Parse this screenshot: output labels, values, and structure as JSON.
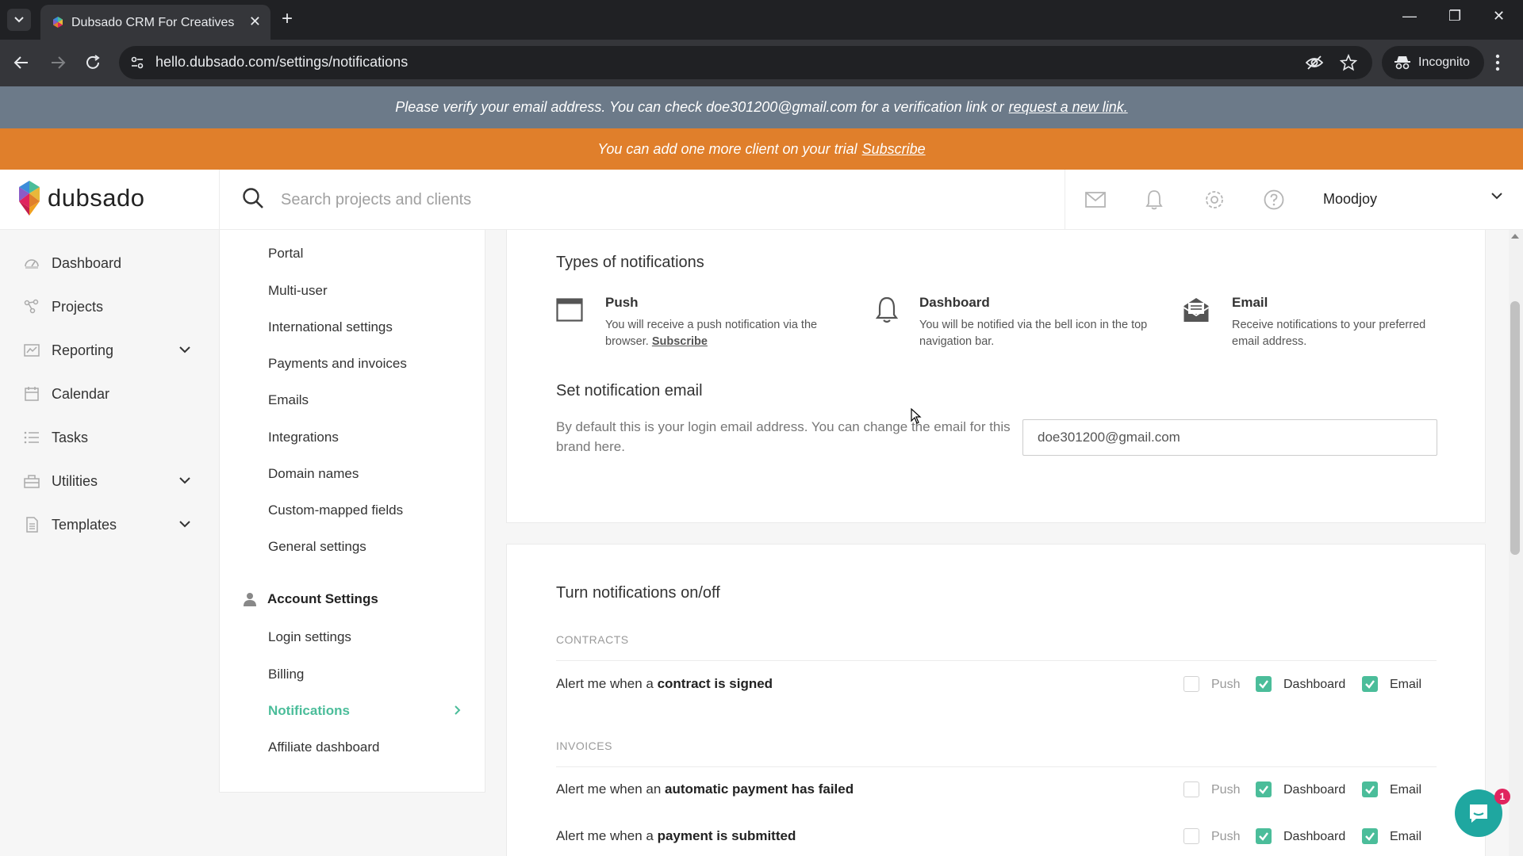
{
  "browser": {
    "tab_title": "Dubsado CRM For Creatives",
    "url": "hello.dubsado.com/settings/notifications",
    "incognito_label": "Incognito"
  },
  "banners": {
    "verify_text": "Please verify your email address. You can check doe301200@gmail.com for a verification link or",
    "verify_link": "request a new link.",
    "trial_text": "You can add one more client on your trial",
    "trial_link": "Subscribe"
  },
  "header": {
    "logo_text": "dubsado",
    "search_placeholder": "Search projects and clients",
    "user_name": "Moodjoy"
  },
  "leftnav": {
    "items": [
      {
        "label": "Dashboard",
        "icon": "dashboard-icon"
      },
      {
        "label": "Projects",
        "icon": "projects-icon"
      },
      {
        "label": "Reporting",
        "icon": "reporting-icon",
        "expandable": true
      },
      {
        "label": "Calendar",
        "icon": "calendar-icon"
      },
      {
        "label": "Tasks",
        "icon": "tasks-icon"
      },
      {
        "label": "Utilities",
        "icon": "utilities-icon",
        "expandable": true
      },
      {
        "label": "Templates",
        "icon": "templates-icon",
        "expandable": true
      }
    ]
  },
  "submenu": {
    "brand_items": [
      "Portal",
      "Multi-user",
      "International settings",
      "Payments and invoices",
      "Emails",
      "Integrations",
      "Domain names",
      "Custom-mapped fields",
      "General settings"
    ],
    "account_section": "Account Settings",
    "account_items": [
      "Login settings",
      "Billing",
      "Notifications",
      "Affiliate dashboard"
    ],
    "active": "Notifications"
  },
  "types": {
    "heading": "Types of notifications",
    "push": {
      "title": "Push",
      "desc": "You will receive a push notification via the browser.",
      "link": "Subscribe"
    },
    "dashboard": {
      "title": "Dashboard",
      "desc": "You will be notified via the bell icon in the top navigation bar."
    },
    "email": {
      "title": "Email",
      "desc": "Receive notifications to your preferred email address."
    }
  },
  "notification_email": {
    "heading": "Set notification email",
    "desc": "By default this is your login email address. You can change the email for this brand here.",
    "value": "doe301200@gmail.com"
  },
  "toggles": {
    "heading": "Turn notifications on/off",
    "option_labels": {
      "push": "Push",
      "dashboard": "Dashboard",
      "email": "Email"
    },
    "categories": [
      {
        "label": "CONTRACTS",
        "alerts": [
          {
            "prefix": "Alert me when a",
            "bold": "contract is signed",
            "push": false,
            "dashboard": true,
            "email": true
          }
        ]
      },
      {
        "label": "INVOICES",
        "alerts": [
          {
            "prefix": "Alert me when an",
            "bold": "automatic payment has failed",
            "push": false,
            "dashboard": true,
            "email": true
          },
          {
            "prefix": "Alert me when a",
            "bold": "payment is submitted",
            "push": false,
            "dashboard": true,
            "email": true
          }
        ]
      }
    ]
  },
  "chat": {
    "badge_count": "1"
  },
  "colors": {
    "accent_green": "#4bbd9a",
    "verify_banner": "#6c7a89",
    "trial_banner": "#e07f2b",
    "chat": "#1fa7a0"
  }
}
